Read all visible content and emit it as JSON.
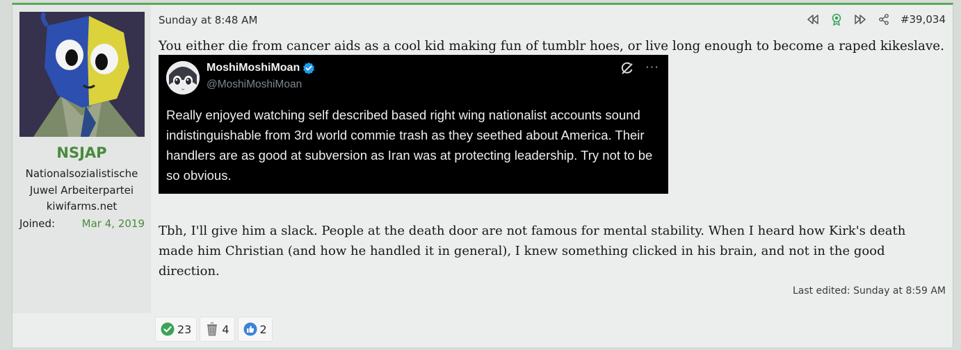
{
  "user": {
    "name": "NSJAP",
    "title_lines": [
      "Nationalsozialistische",
      "Juwel Arbeiterpartei",
      "kiwifarms.net"
    ],
    "joined_label": "Joined:",
    "joined_value": "Mar 4, 2019"
  },
  "post": {
    "date": "Sunday at 8:48 AM",
    "number": "#39,034",
    "text1": "You either die from cancer aids as a cool kid making fun of tumblr hoes, or live long enough to become a raped kikeslave.",
    "text2": "Tbh, I'll give him a slack. People at the death door are not famous for mental stability. When I heard how Kirk's death made him Christian (and how he handled it in general), I knew something clicked in his brain, and not in the good direction.",
    "edited": "Last edited: Sunday at 8:59 AM",
    "actions": [
      {
        "icon": "rewind-icon"
      },
      {
        "icon": "award-icon"
      },
      {
        "icon": "fast-forward-icon"
      },
      {
        "icon": "share-icon"
      }
    ]
  },
  "tweet": {
    "display_name": "MoshiMoshiMoan",
    "handle": "@MoshiMoshiMoan",
    "text": "Really enjoyed watching self described based right wing nationalist accounts sound indistinguishable from 3rd world commie trash as they seethed about America.  Their handlers are as good at subversion as Iran was at protecting leadership.  Try not to be so obvious.",
    "more": "···"
  },
  "reactions": [
    {
      "icon": "check-circle-icon",
      "count": "23",
      "color": "#3aa357"
    },
    {
      "icon": "dumpster-icon",
      "count": "4",
      "color": "#9a9a9a"
    },
    {
      "icon": "thumbs-up-icon",
      "count": "2",
      "color": "#3c82d8"
    }
  ],
  "colors": {
    "accent": "#4a8a3e",
    "border_top": "#58a858",
    "user_bg": "#e3e6e4",
    "post_bg": "#eceeed"
  }
}
